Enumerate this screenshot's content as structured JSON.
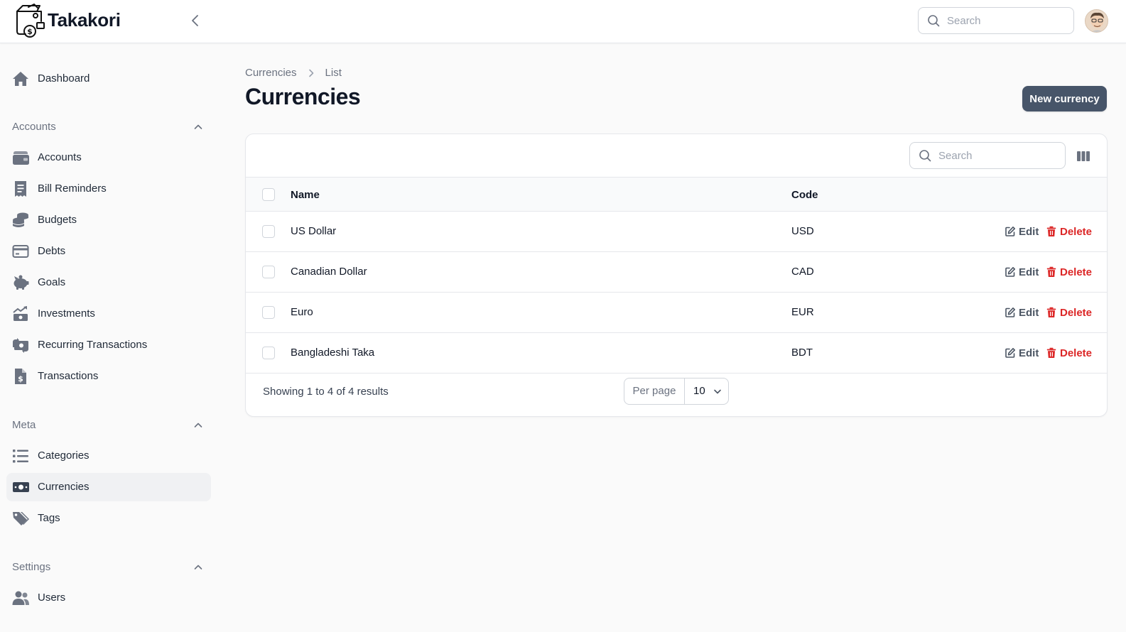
{
  "app": {
    "name": "Takakori"
  },
  "header": {
    "search_placeholder": "Search"
  },
  "sidebar": {
    "dashboard": {
      "label": "Dashboard"
    },
    "groups": [
      {
        "label": "Accounts",
        "items": [
          {
            "label": "Accounts",
            "icon": "wallet-icon"
          },
          {
            "label": "Bill Reminders",
            "icon": "receipt-icon"
          },
          {
            "label": "Budgets",
            "icon": "coins-icon"
          },
          {
            "label": "Debts",
            "icon": "credit-card-icon"
          },
          {
            "label": "Goals",
            "icon": "piggy-bank-icon"
          },
          {
            "label": "Investments",
            "icon": "chart-money-icon"
          },
          {
            "label": "Recurring Transactions",
            "icon": "recurring-money-icon"
          },
          {
            "label": "Transactions",
            "icon": "dollar-document-icon"
          }
        ]
      },
      {
        "label": "Meta",
        "items": [
          {
            "label": "Categories",
            "icon": "list-icon"
          },
          {
            "label": "Currencies",
            "icon": "banknote-icon",
            "active": true
          },
          {
            "label": "Tags",
            "icon": "tags-icon"
          }
        ]
      },
      {
        "label": "Settings",
        "items": [
          {
            "label": "Users",
            "icon": "users-icon"
          }
        ]
      }
    ]
  },
  "page": {
    "breadcrumb": [
      "Currencies",
      "List"
    ],
    "title": "Currencies",
    "new_button": "New currency"
  },
  "table": {
    "search_placeholder": "Search",
    "columns": [
      "Name",
      "Code"
    ],
    "rows": [
      {
        "name": "US Dollar",
        "code": "USD"
      },
      {
        "name": "Canadian Dollar",
        "code": "CAD"
      },
      {
        "name": "Euro",
        "code": "EUR"
      },
      {
        "name": "Bangladeshi Taka",
        "code": "BDT"
      }
    ],
    "actions": {
      "edit": "Edit",
      "delete": "Delete"
    },
    "footer": {
      "summary": "Showing 1 to 4 of 4 results",
      "per_page_label": "Per page",
      "per_page_value": "10"
    }
  },
  "colors": {
    "primary_button": "#475569",
    "danger": "#dc2626",
    "active_nav_bg": "#f0f1f3"
  }
}
